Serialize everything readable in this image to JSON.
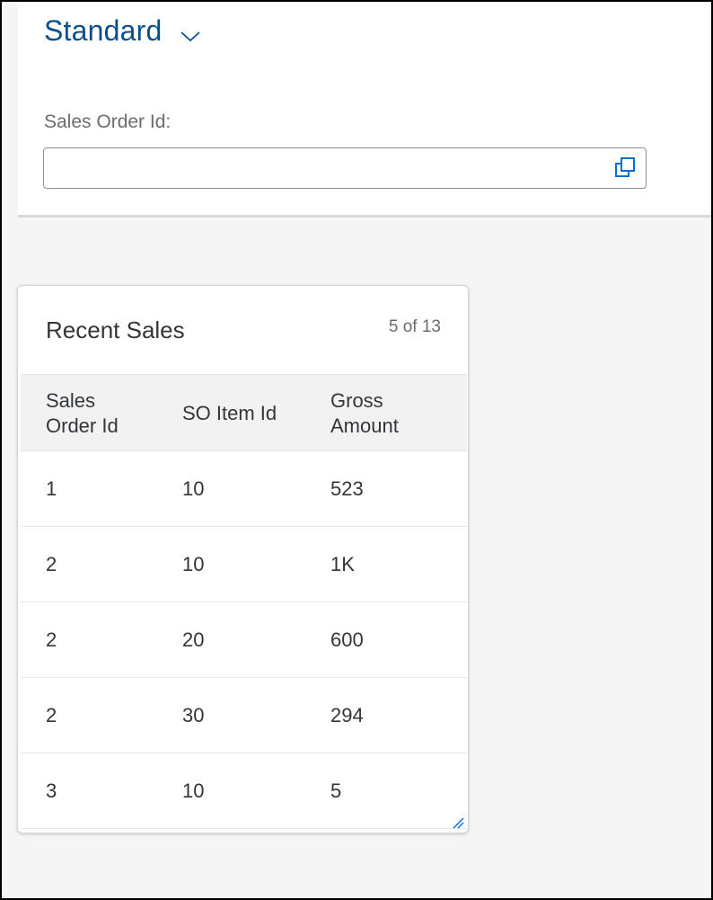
{
  "variant": {
    "title": "Standard"
  },
  "filter": {
    "sales_order_label": "Sales Order Id:",
    "sales_order_value": ""
  },
  "card": {
    "title": "Recent Sales",
    "count": "5 of 13",
    "columns": {
      "sales_order_line1": "Sales",
      "sales_order_line2": "Order Id",
      "so_item": "SO Item Id",
      "gross_line1": "Gross",
      "gross_line2": "Amount"
    },
    "rows": [
      {
        "sales_order": "1",
        "so_item": "10",
        "gross": "523"
      },
      {
        "sales_order": "2",
        "so_item": "10",
        "gross": "1K"
      },
      {
        "sales_order": "2",
        "so_item": "20",
        "gross": "600"
      },
      {
        "sales_order": "2",
        "so_item": "30",
        "gross": "294"
      },
      {
        "sales_order": "3",
        "so_item": "10",
        "gross": "5"
      }
    ]
  },
  "colors": {
    "accent": "#0a4f8c",
    "background": "#f5f5f5",
    "table_header": "#f2f2f2"
  },
  "icons": {
    "variant_toggle": "chevron-down-icon",
    "value_help": "value-help-icon",
    "resize": "resize-handle-icon"
  }
}
